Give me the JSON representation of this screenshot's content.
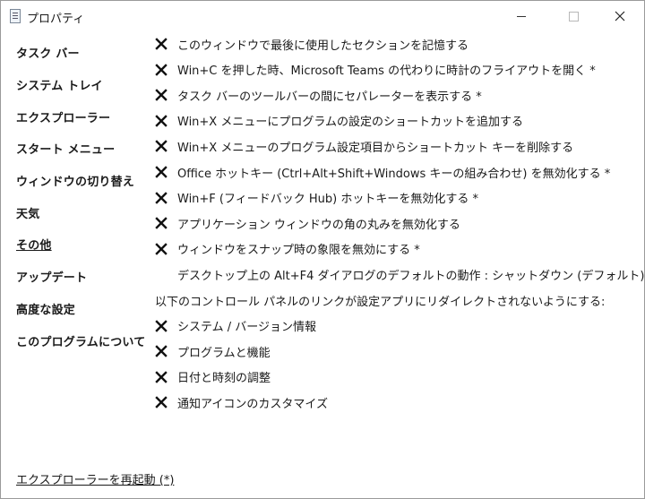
{
  "window": {
    "title": "プロパティ"
  },
  "sidebar": {
    "items": [
      {
        "label": "タスク バー",
        "active": false
      },
      {
        "label": "システム トレイ",
        "active": false
      },
      {
        "label": "エクスプローラー",
        "active": false
      },
      {
        "label": "スタート メニュー",
        "active": false
      },
      {
        "label": "ウィンドウの切り替え",
        "active": false
      },
      {
        "label": "天気",
        "active": false
      },
      {
        "label": "その他",
        "active": true
      },
      {
        "label": "アップデート",
        "active": false
      },
      {
        "label": "高度な設定",
        "active": false
      },
      {
        "label": "このプログラムについて",
        "active": false
      }
    ],
    "footer_link": "エクスプローラーを再起動 (*)"
  },
  "main": {
    "options": [
      {
        "label": "このウィンドウで最後に使用したセクションを記憶する",
        "state": "x-mark"
      },
      {
        "label": "Win+C を押した時、Microsoft Teams の代わりに時計のフライアウトを開く *",
        "state": "x-mark"
      },
      {
        "label": "タスク バーのツールバーの間にセパレーターを表示する *",
        "state": "x-mark"
      },
      {
        "label": "Win+X メニューにプログラムの設定のショートカットを追加する",
        "state": "x-mark"
      },
      {
        "label": "Win+X メニューのプログラム設定項目からショートカット キーを削除する",
        "state": "x-mark"
      },
      {
        "label": "Office ホットキー (Ctrl+Alt+Shift+Windows キーの組み合わせ) を無効化する *",
        "state": "x-mark"
      },
      {
        "label": "Win+F (フィードバック Hub) ホットキーを無効化する *",
        "state": "x-mark"
      },
      {
        "label": "アプリケーション ウィンドウの角の丸みを無効化する",
        "state": "x-mark"
      },
      {
        "label": "ウィンドウをスナップ時の象限を無効にする *",
        "state": "x-mark"
      }
    ],
    "alt_f4_setting": "デスクトップ上の Alt+F4 ダイアログのデフォルトの動作 : シャットダウン (デフォルト)",
    "control_panel_heading": "以下のコントロール パネルのリンクが設定アプリにリダイレクトされないようにする:",
    "control_panel_options": [
      {
        "label": "システム / バージョン情報",
        "state": "x-mark"
      },
      {
        "label": "プログラムと機能",
        "state": "x-mark"
      },
      {
        "label": "日付と時刻の調整",
        "state": "x-mark"
      },
      {
        "label": "通知アイコンのカスタマイズ",
        "state": "x-mark"
      }
    ]
  },
  "icons": {
    "option_state": "x-mark-icon",
    "close": "close-icon",
    "minimize": "minimize-icon",
    "maximize": "maximize-icon"
  }
}
